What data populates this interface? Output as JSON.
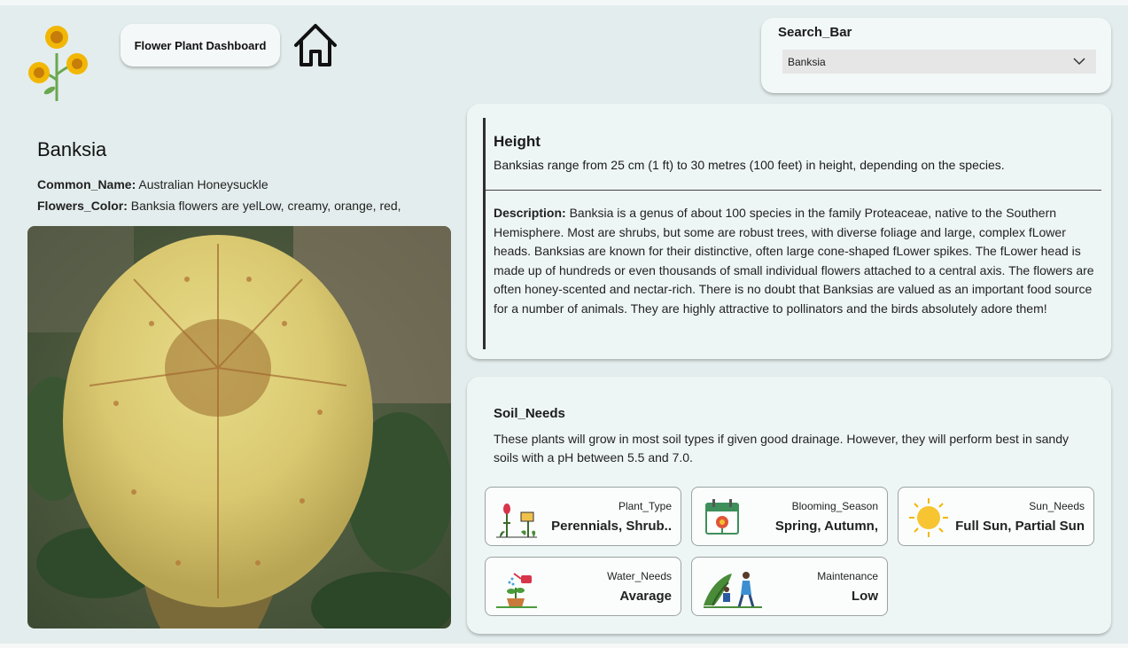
{
  "header": {
    "dashboard_title": "Flower Plant Dashboard"
  },
  "search": {
    "label": "Search_Bar",
    "selected": "Banksia"
  },
  "plant": {
    "name": "Banksia",
    "common_name_label": "Common_Name:",
    "common_name": "Australian Honeysuckle",
    "flowers_color_label": "Flowers_Color:",
    "flowers_color": "Banksia flowers are yelLow, creamy, orange, red,"
  },
  "height": {
    "title": "Height",
    "text": "Banksias range from 25 cm (1 ft) to 30 metres (100 feet) in height, depending on the species."
  },
  "description": {
    "label": "Description:",
    "text": "Banksia is a genus of about 100 species in the family Proteaceae, native to the Southern Hemisphere. Most are shrubs, but some are robust trees, with diverse foliage and large, complex fLower heads. Banksias are known for their distinctive, often large cone-shaped fLower spikes. The fLower head is made up of hundreds or even thousands of small individual flowers attached to a central axis. The flowers are often honey-scented and nectar-rich. There is no doubt that Banksias are valued as an important food source for a number of animals. They are highly attractive to pollinators and the birds absolutely adore them!"
  },
  "soil": {
    "title": "Soil_Needs",
    "text": "These plants will grow in most soil types if given good drainage. However, they will perform best in sandy soils with a pH between 5.5 and 7.0."
  },
  "tiles": [
    {
      "label": "Plant_Type",
      "value": "Perennials, Shrub..",
      "icon": "plant-type-icon"
    },
    {
      "label": "Blooming_Season",
      "value": "Spring, Autumn,",
      "icon": "calendar-flower-icon"
    },
    {
      "label": "Sun_Needs",
      "value": "Full Sun, Partial Sun",
      "icon": "sun-icon"
    },
    {
      "label": "Water_Needs",
      "value": "Avarage",
      "icon": "watering-can-icon"
    },
    {
      "label": "Maintenance",
      "value": "Low",
      "icon": "gardeners-icon"
    }
  ],
  "colors": {
    "background": "#e4eded",
    "card": "#eef5f5",
    "flower_yellow": "#f2c12e"
  }
}
